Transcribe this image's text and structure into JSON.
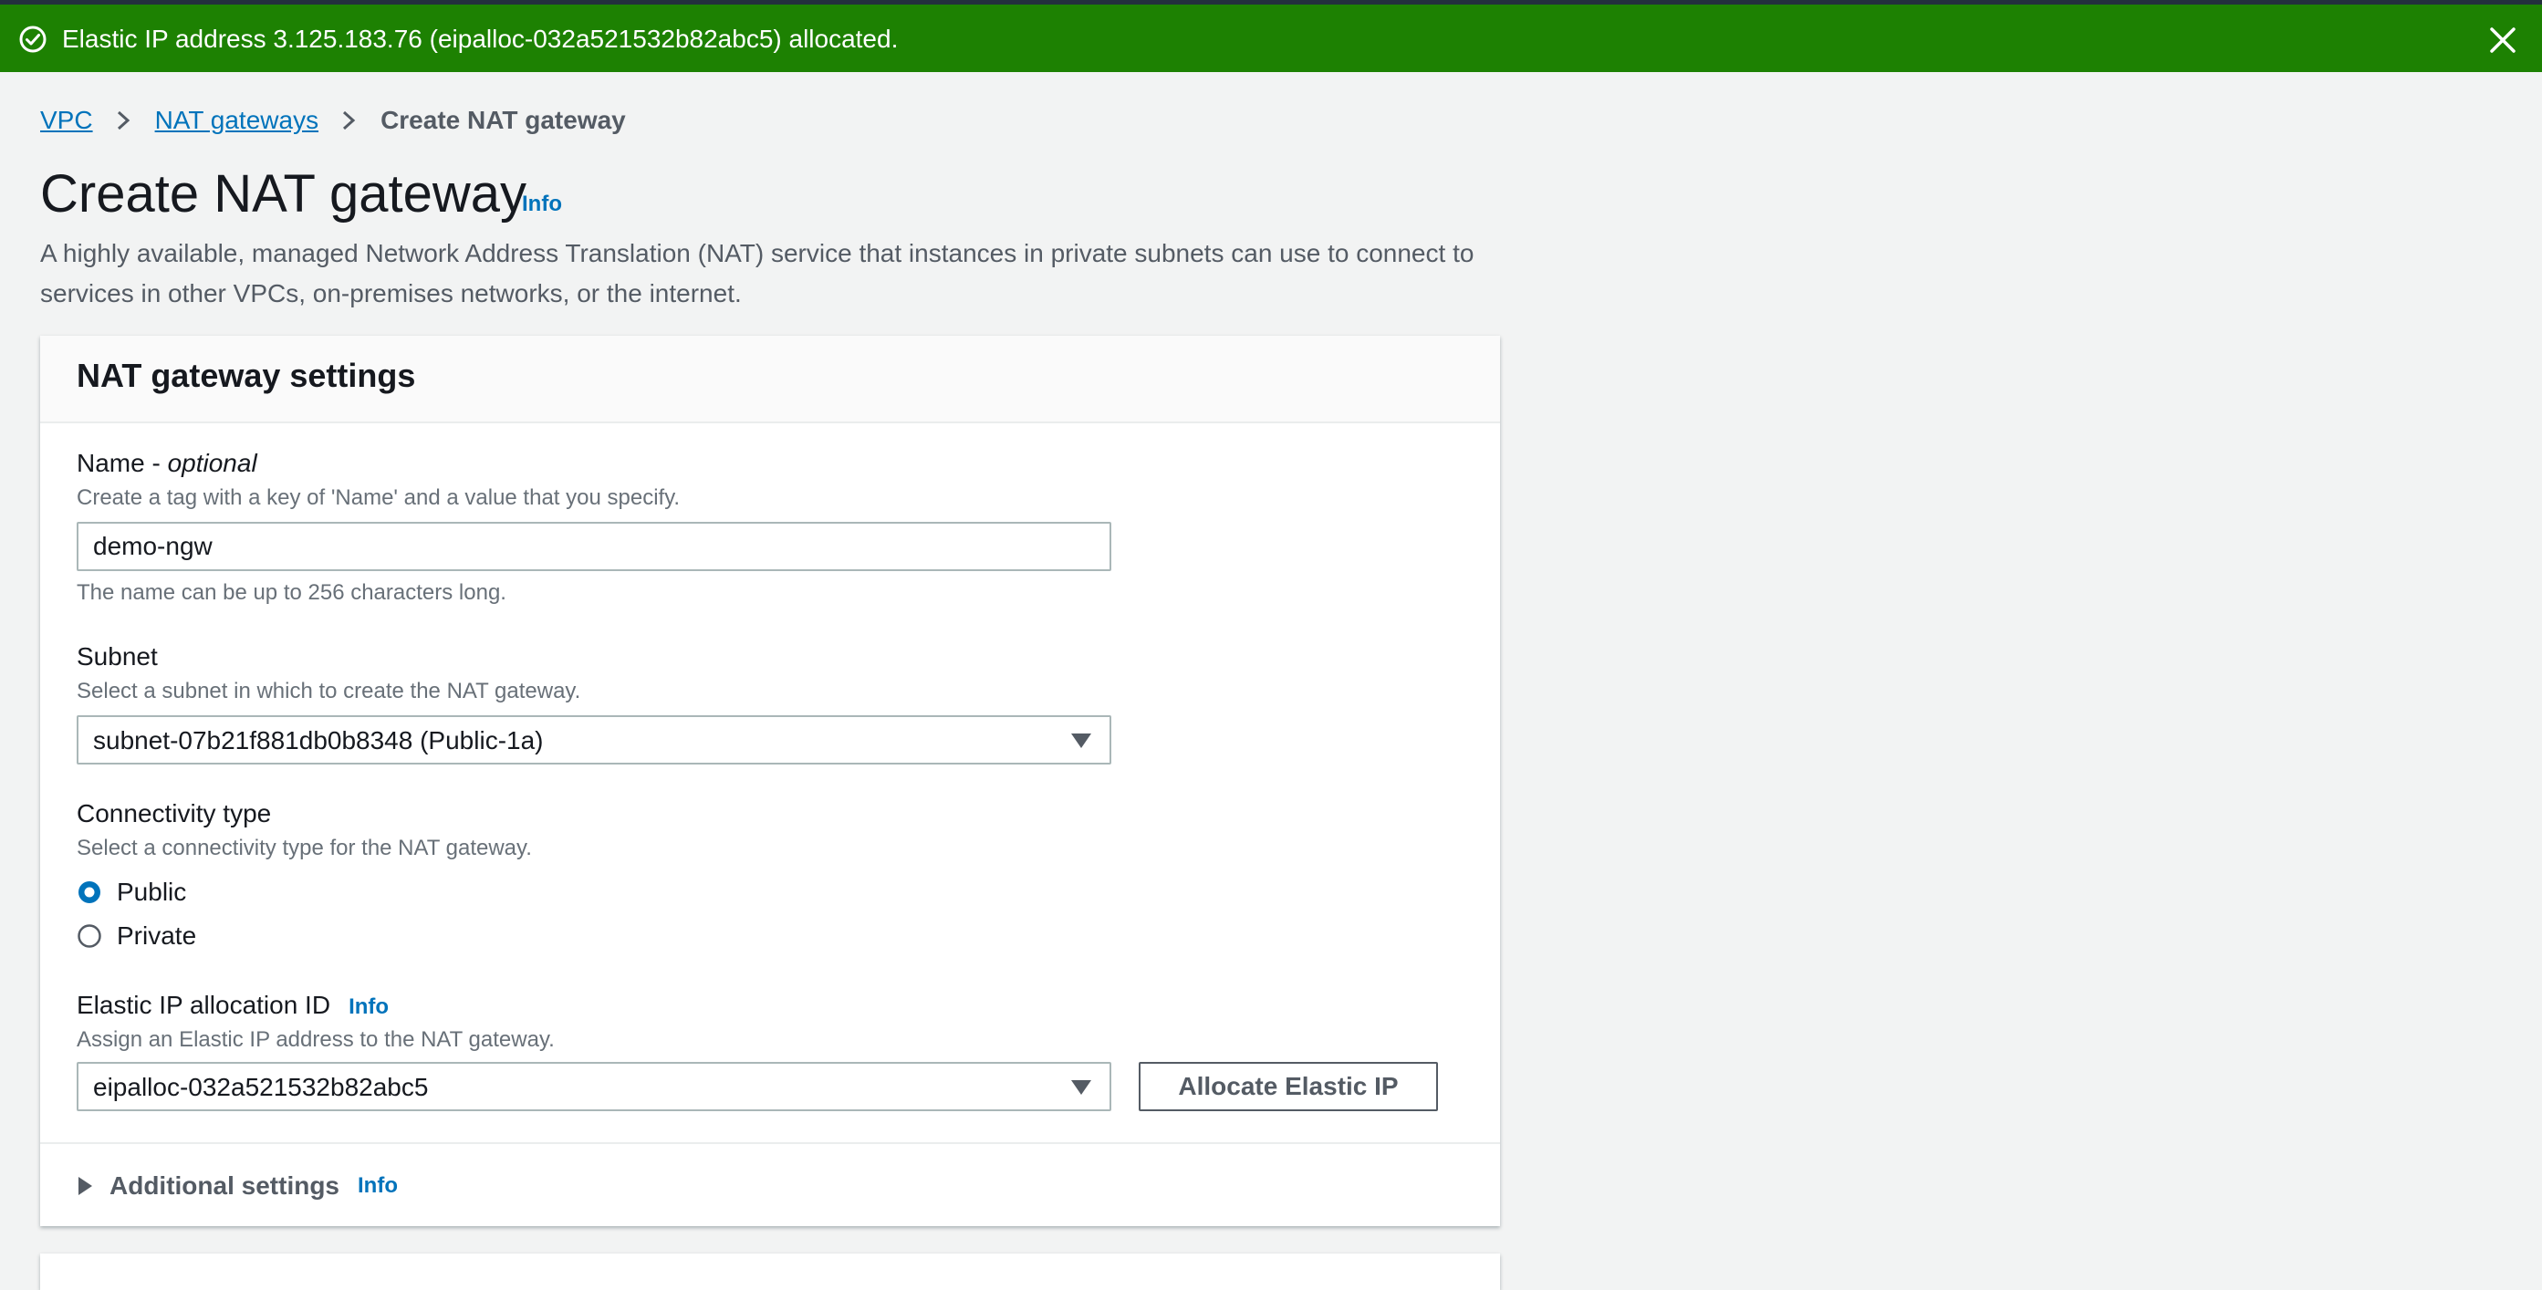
{
  "colors": {
    "success": "#1d8102",
    "link": "#0073bb",
    "radio_selected": "#0073bb"
  },
  "flash": {
    "message": "Elastic IP address 3.125.183.76 (eipalloc-032a521532b82abc5) allocated.",
    "icon": "check-circle-icon",
    "close_icon": "close-icon"
  },
  "breadcrumb": {
    "items": [
      "VPC",
      "NAT gateways"
    ],
    "current": "Create NAT gateway"
  },
  "page": {
    "title": "Create NAT gateway",
    "info": "Info",
    "description": "A highly available, managed Network Address Translation (NAT) service that instances in private subnets can use to connect to services in other VPCs, on-premises networks, or the internet."
  },
  "settings": {
    "heading": "NAT gateway settings",
    "name": {
      "label": "Name - ",
      "label_optional": "optional",
      "hint": "Create a tag with a key of 'Name' and a value that you specify.",
      "value": "demo-ngw",
      "constraint": "The name can be up to 256 characters long."
    },
    "subnet": {
      "label": "Subnet",
      "hint": "Select a subnet in which to create the NAT gateway.",
      "value": "subnet-07b21f881db0b8348 (Public-1a)"
    },
    "connectivity": {
      "label": "Connectivity type",
      "hint": "Select a connectivity type for the NAT gateway.",
      "options": [
        "Public",
        "Private"
      ],
      "selected": "Public"
    },
    "eip": {
      "label": "Elastic IP allocation ID",
      "info": "Info",
      "hint": "Assign an Elastic IP address to the NAT gateway.",
      "value": "eipalloc-032a521532b82abc5",
      "button": "Allocate Elastic IP"
    },
    "additional": {
      "label": "Additional settings",
      "info": "Info"
    }
  }
}
